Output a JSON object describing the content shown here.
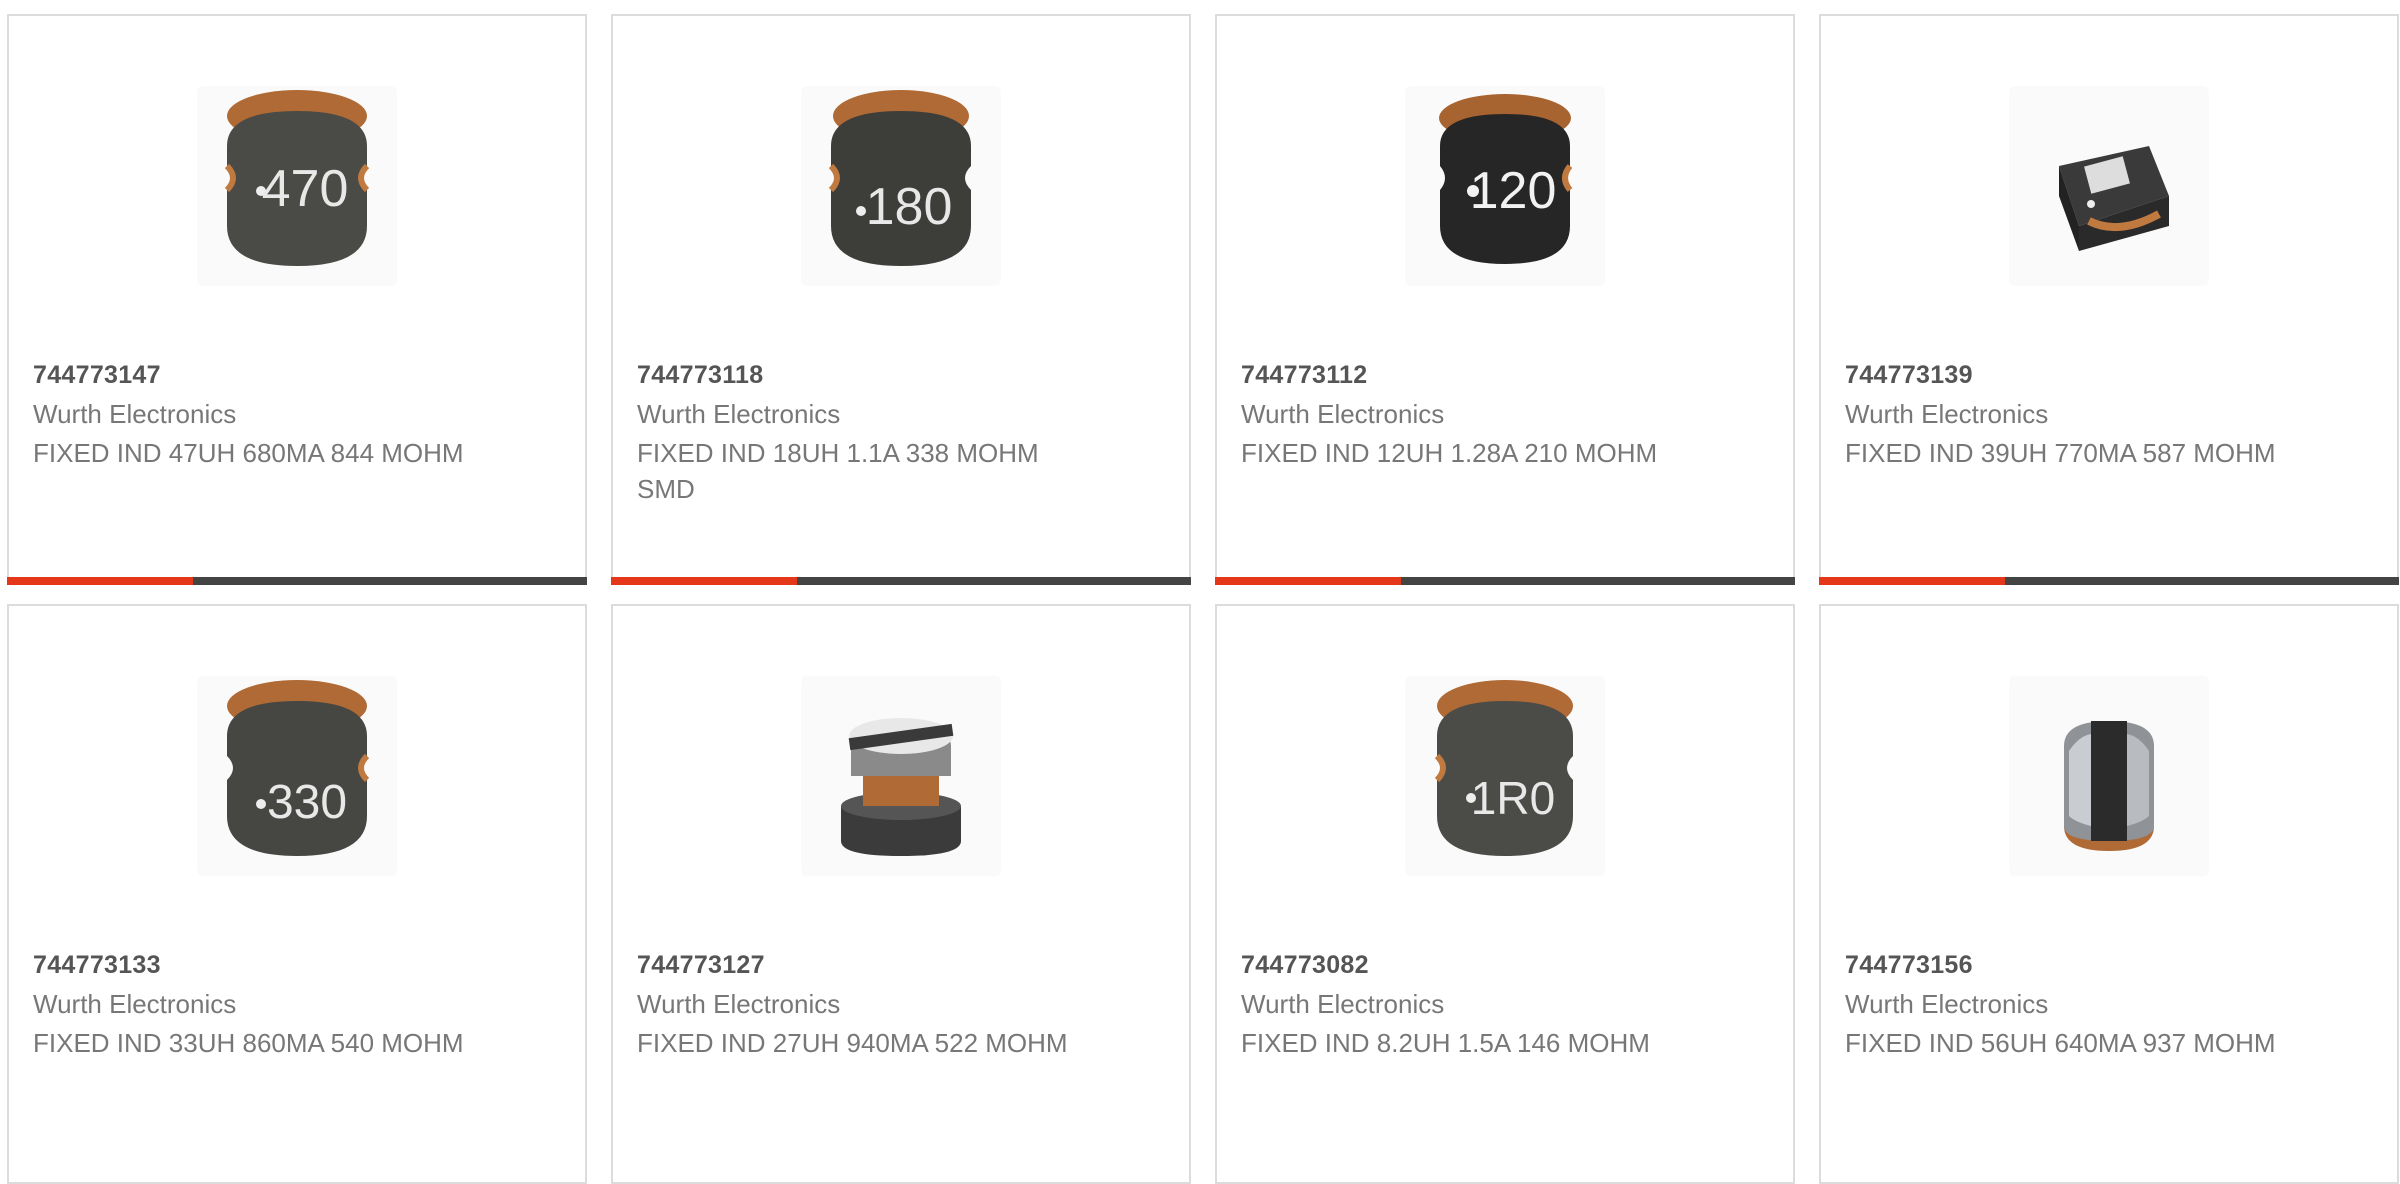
{
  "colors": {
    "accent": "#e5381a",
    "track": "#444444",
    "border": "#dcdcdc"
  },
  "products": [
    {
      "part_number": "744773147",
      "manufacturer": "Wurth Electronics",
      "description": "FIXED IND 47UH 680MA 844 MOHM",
      "marking": "470",
      "image": "shielded-inductor-470"
    },
    {
      "part_number": "744773118",
      "manufacturer": "Wurth Electronics",
      "description": "FIXED IND 18UH 1.1A 338 MOHM SMD",
      "marking": "180",
      "image": "shielded-inductor-180"
    },
    {
      "part_number": "744773112",
      "manufacturer": "Wurth Electronics",
      "description": "FIXED IND 12UH 1.28A 210 MOHM",
      "marking": "120",
      "image": "shielded-inductor-120"
    },
    {
      "part_number": "744773139",
      "manufacturer": "Wurth Electronics",
      "description": "FIXED IND 39UH 770MA 587 MOHM",
      "marking": "",
      "image": "shielded-inductor-angled"
    },
    {
      "part_number": "744773133",
      "manufacturer": "Wurth Electronics",
      "description": "FIXED IND 33UH 860MA 540 MOHM",
      "marking": "330",
      "image": "shielded-inductor-330"
    },
    {
      "part_number": "744773127",
      "manufacturer": "Wurth Electronics",
      "description": "FIXED IND 27UH 940MA 522 MOHM",
      "marking": "",
      "image": "shielded-inductor-side"
    },
    {
      "part_number": "744773082",
      "manufacturer": "Wurth Electronics",
      "description": "FIXED IND 8.2UH 1.5A 146 MOHM",
      "marking": "1R0",
      "image": "shielded-inductor-1r0"
    },
    {
      "part_number": "744773156",
      "manufacturer": "Wurth Electronics",
      "description": "FIXED IND 56UH 640MA 937 MOHM",
      "marking": "",
      "image": "shielded-inductor-front"
    }
  ],
  "progress": [
    0.32,
    0.32,
    0.32,
    0.32
  ]
}
